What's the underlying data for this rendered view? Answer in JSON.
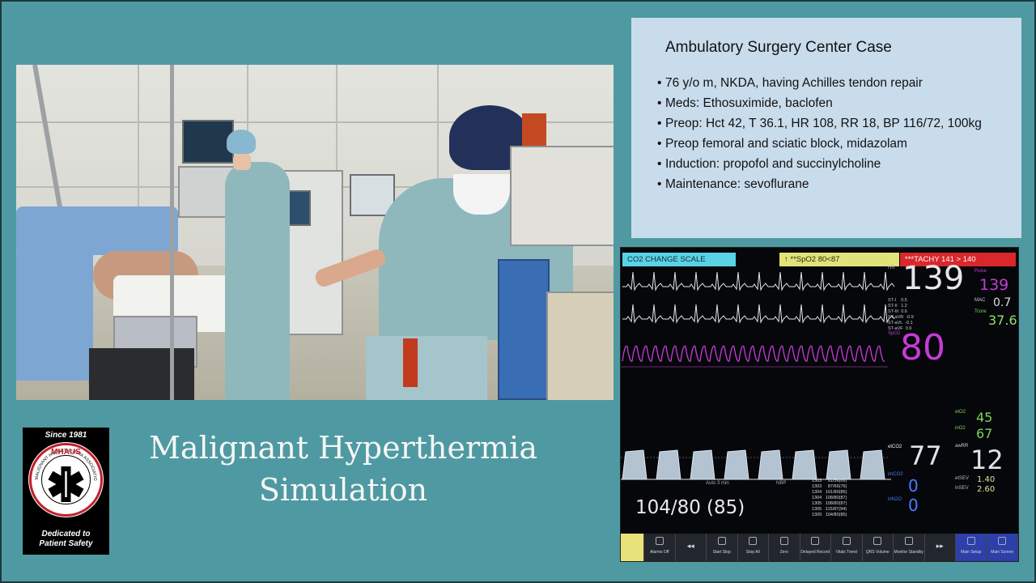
{
  "case": {
    "title": "Ambulatory Surgery Center Case",
    "items": [
      "76 y/o m, NKDA, having Achilles tendon repair",
      "Meds: Ethosuximide, baclofen",
      "Preop: Hct 42, T 36.1, HR 108, RR 18, BP 116/72, 100kg",
      "Preop femoral and sciatic block, midazolam",
      "Induction: propofol and succinylcholine",
      "Maintenance: sevoflurane"
    ]
  },
  "title": {
    "line1": "Malignant Hyperthermia",
    "line2": "Simulation"
  },
  "logo": {
    "since": "Since 1981",
    "acronym": "MHAUS",
    "ring_text": "MALIGNANT HYPERTHERMIA ASSOCIATION OF THE UNITED STATES",
    "dedicated_line1": "Dedicated to",
    "dedicated_line2": "Patient Safety"
  },
  "monitor": {
    "alarms": {
      "co2": "CO2  CHANGE SCALE",
      "spo2": "↑  **SpO2   80<87",
      "tachy": "***TACHY 141 > 140"
    },
    "hr": {
      "label": "HR",
      "value": "139"
    },
    "spo2": {
      "label": "SpO2",
      "value": "80"
    },
    "etco2": {
      "label": "etCO2",
      "value": "77"
    },
    "imco2": {
      "label": "imCO2",
      "value": "0"
    },
    "inn2o": {
      "label": "inN2O",
      "value": "0"
    },
    "pulse": {
      "label": "Pulse",
      "value": "139"
    },
    "mac": {
      "label": "MAC",
      "value": "0.7"
    },
    "tcore": {
      "label": "Tcore",
      "value": "37.6"
    },
    "gas1": {
      "label": "etO2",
      "value": "45"
    },
    "gas2": {
      "label": "inO2",
      "value": "67"
    },
    "awrr": {
      "label": "awRR",
      "value": "12"
    },
    "etsev": {
      "label": "etSEV",
      "value": "1.40"
    },
    "insev": {
      "label": "inSEV",
      "value": "2.60"
    },
    "nbp": {
      "label": "NBP",
      "value": "104/80",
      "mean": "(85)",
      "mode": "Auto 3 min"
    },
    "nbp_list": "1303     91/56(69)\n1303     87/66(76)\n1304   101/80(85)\n1304   108/80(87)\n1305   108/80(87)\n1305   115/87(94)\n1309   104/80(85)",
    "st_list": "ST-I    0.5\nST-II   1.2\nST-III  0.6\nST-aVR  -0.9\nST-aVL  -0.1\nST-aVF  0.9",
    "softkeys": [
      "Alarms Off",
      "",
      "Start Stop",
      "Stop All",
      "Zero",
      "Delayed Record",
      "Vitals Trend",
      "QRS Volume",
      "Monitor Standby",
      "",
      "Main Setup",
      "Main Screen"
    ]
  }
}
